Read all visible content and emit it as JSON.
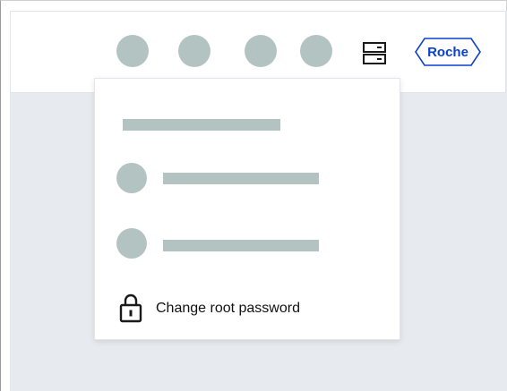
{
  "header": {
    "icons": [
      "avatar-placeholder",
      "avatar-placeholder",
      "avatar-placeholder",
      "avatar-placeholder",
      "server-icon"
    ],
    "logo_text": "Roche",
    "logo_color": "#0b41cd"
  },
  "menu": {
    "items": [
      {
        "icon": "avatar-placeholder"
      },
      {
        "icon": "avatar-placeholder"
      }
    ],
    "change_password": {
      "icon": "lock-icon",
      "label": "Change root password"
    }
  },
  "colors": {
    "placeholder": "#b3c3c2",
    "background": "#e7eaee",
    "surface": "#ffffff"
  }
}
